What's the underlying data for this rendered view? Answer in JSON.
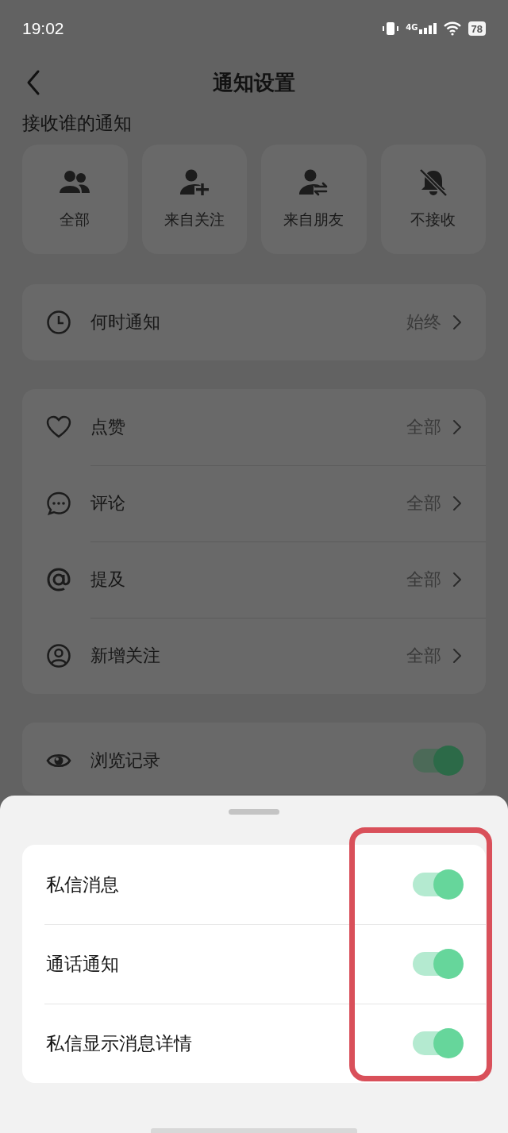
{
  "status_bar": {
    "time": "19:02",
    "network": "4G",
    "battery": "78"
  },
  "header": {
    "title": "通知设置"
  },
  "receive_from": {
    "title": "接收谁的通知",
    "options": [
      {
        "label": "全部",
        "kind": "group"
      },
      {
        "label": "来自关注",
        "kind": "follow"
      },
      {
        "label": "来自朋友",
        "kind": "friend"
      },
      {
        "label": "不接收",
        "kind": "mute"
      }
    ]
  },
  "when": {
    "label": "何时通知",
    "value": "始终"
  },
  "categories": [
    {
      "label": "点赞",
      "value": "全部",
      "kind": "heart"
    },
    {
      "label": "评论",
      "value": "全部",
      "kind": "comment"
    },
    {
      "label": "提及",
      "value": "全部",
      "kind": "at"
    },
    {
      "label": "新增关注",
      "value": "全部",
      "kind": "person"
    }
  ],
  "browse_history": {
    "label": "浏览记录",
    "on": true
  },
  "sheet": {
    "items": [
      {
        "label": "私信消息",
        "on": true
      },
      {
        "label": "通话通知",
        "on": true
      },
      {
        "label": "私信显示消息详情",
        "on": true
      }
    ]
  }
}
